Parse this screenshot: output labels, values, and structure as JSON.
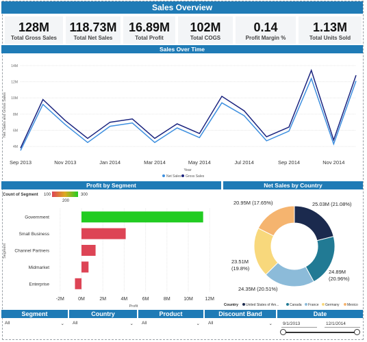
{
  "title": "Sales Overview",
  "kpis": [
    {
      "value": "128M",
      "label": "Total Gross Sales"
    },
    {
      "value": "118.73M",
      "label": "Total Net Sales"
    },
    {
      "value": "16.89M",
      "label": "Total Profit"
    },
    {
      "value": "102M",
      "label": "Total COGS"
    },
    {
      "value": "0.14",
      "label": "Profit Margin %"
    },
    {
      "value": "1.13M",
      "label": "Total Units Sold"
    }
  ],
  "line_chart": {
    "title": "Sales Over Time",
    "ylabel": "Net Sales and Gross Sales",
    "xlabel": "Year",
    "y_ticks": [
      "4M",
      "6M",
      "8M",
      "10M",
      "12M",
      "14M"
    ],
    "x_ticks": [
      "Sep 2013",
      "Nov 2013",
      "Jan 2014",
      "Mar 2014",
      "May 2014",
      "Jul 2014",
      "Sep 2014",
      "Nov 2014"
    ],
    "legend": [
      "Net Sales",
      "Gross Sales"
    ],
    "colors": {
      "net": "#3d8fdf",
      "gross": "#1a237e"
    }
  },
  "bar_chart": {
    "title": "Profit by Segment",
    "legend_title": "Count of Segment",
    "legend_min": "100",
    "legend_mid": "200",
    "legend_max": "300",
    "ylabel": "Segment",
    "xlabel": "Profit",
    "x_ticks": [
      "-2M",
      "0M",
      "2M",
      "4M",
      "6M",
      "8M",
      "10M",
      "12M"
    ]
  },
  "donut": {
    "title": "Net Sales by Country",
    "legend_title": "Country",
    "legend_items": [
      "United States of Am...",
      "Canada",
      "France",
      "Germany",
      "Mexico"
    ],
    "labels": [
      {
        "line1": "25.03M (21.08%)",
        "line2": ""
      },
      {
        "line1": "24.89M",
        "line2": "(20.96%)"
      },
      {
        "line1": "24.35M (20.51%)",
        "line2": ""
      },
      {
        "line1": "23.51M",
        "line2": "(19.8%)"
      },
      {
        "line1": "20.95M (17.65%)",
        "line2": ""
      }
    ]
  },
  "chart_data": [
    {
      "type": "line",
      "title": "Sales Over Time",
      "xlabel": "Year",
      "ylabel": "Net Sales and Gross Sales",
      "x": [
        "2013-09",
        "2013-10",
        "2013-11",
        "2013-12",
        "2014-01",
        "2014-02",
        "2014-03",
        "2014-04",
        "2014-05",
        "2014-06",
        "2014-07",
        "2014-08",
        "2014-09",
        "2014-10",
        "2014-11",
        "2014-12"
      ],
      "ylim": [
        3,
        15
      ],
      "series": [
        {
          "name": "Net Sales",
          "color": "#3d8fdf",
          "values": [
            3.5,
            9.2,
            6.7,
            4.5,
            6.5,
            6.9,
            4.5,
            6.3,
            5.1,
            9.4,
            7.8,
            4.7,
            5.9,
            12.4,
            4.3,
            12.1
          ]
        },
        {
          "name": "Gross Sales",
          "color": "#1a237e",
          "values": [
            3.8,
            9.8,
            7.2,
            5.0,
            7.0,
            7.4,
            5.0,
            6.8,
            5.6,
            10.2,
            8.4,
            5.2,
            6.4,
            13.4,
            4.8,
            12.8
          ]
        }
      ],
      "legend": "bottom-center",
      "grid": true
    },
    {
      "type": "bar",
      "title": "Profit by Segment",
      "xlabel": "Profit",
      "ylabel": "Segment",
      "categories": [
        "Government",
        "Small Business",
        "Channel Partners",
        "Midmarket",
        "Enterprise"
      ],
      "values": [
        11.39,
        4.14,
        1.32,
        0.66,
        -0.61
      ],
      "count_of_segment": [
        300,
        100,
        100,
        100,
        100
      ],
      "colors": [
        "#22cc22",
        "#dd4455",
        "#dd4455",
        "#dd4455",
        "#dd4455"
      ],
      "xlim": [
        -2.5,
        12.5
      ]
    },
    {
      "type": "pie",
      "title": "Net Sales by Country",
      "categories": [
        "United States of Am...",
        "Canada",
        "France",
        "Germany",
        "Mexico"
      ],
      "values": [
        25.03,
        24.89,
        24.35,
        23.51,
        20.95
      ],
      "percent": [
        21.08,
        20.96,
        20.51,
        19.8,
        17.65
      ],
      "colors": [
        "#1b2a4e",
        "#217a94",
        "#8cbbd9",
        "#f8d87c",
        "#f5b46f"
      ]
    }
  ],
  "slicers": [
    {
      "label": "Segment",
      "value": "All"
    },
    {
      "label": "Country",
      "value": "All"
    },
    {
      "label": "Product",
      "value": "All"
    },
    {
      "label": "Discount Band",
      "value": "All"
    }
  ],
  "date_slicer": {
    "label": "Date",
    "start": "9/1/2013",
    "end": "12/1/2014"
  }
}
